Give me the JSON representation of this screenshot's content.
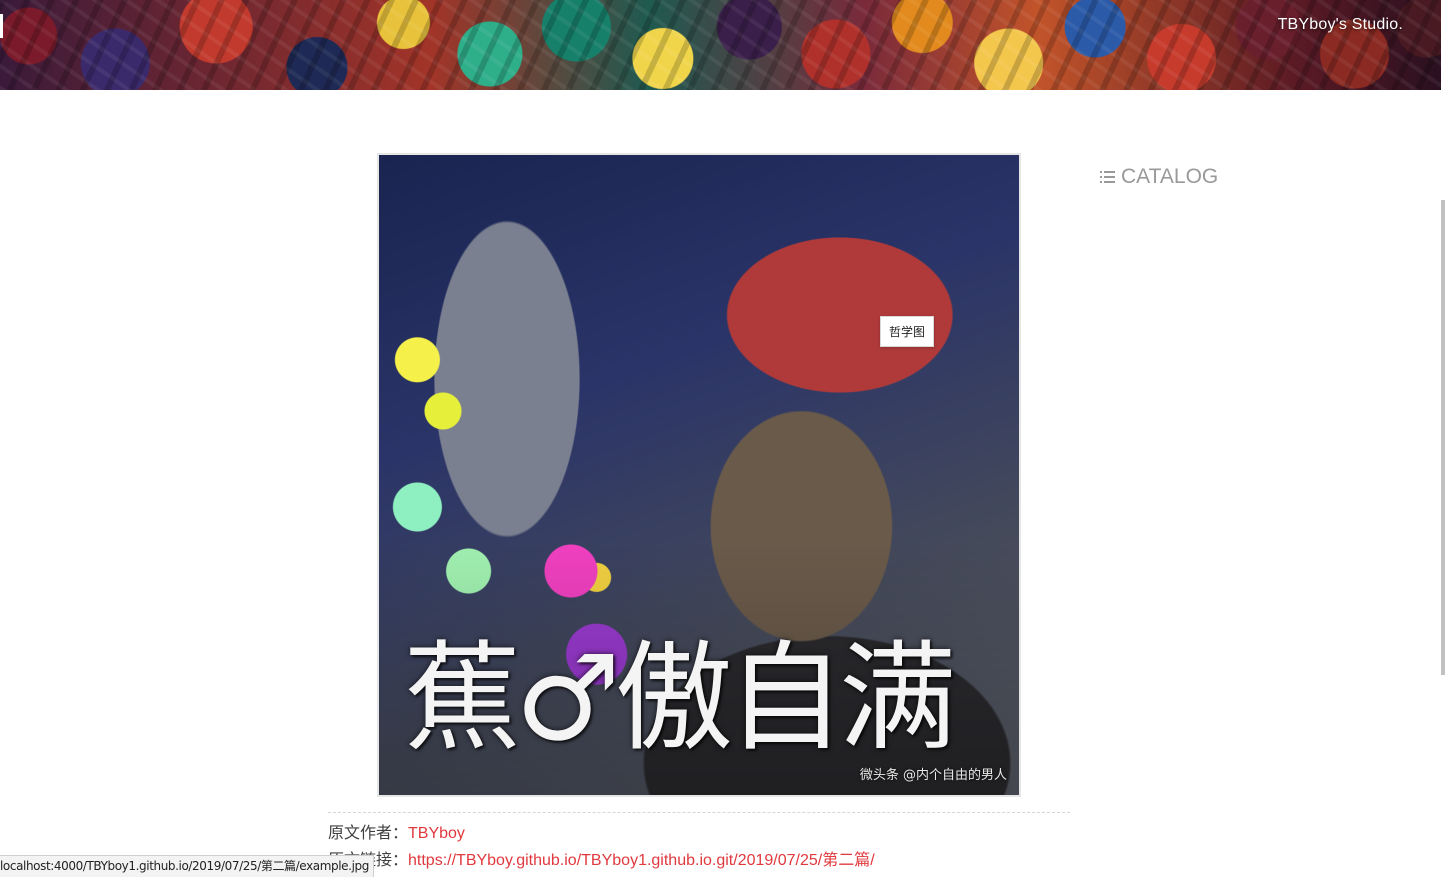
{
  "header": {
    "brand": "TBYboy's Studio."
  },
  "post": {
    "image_alt": "哲学图",
    "image_caption": "蕉♂傲自满",
    "image_watermark": "微头条 @内个自由的男人",
    "tooltip": "哲学图"
  },
  "sidebar": {
    "catalog_label": "CATALOG"
  },
  "copyright": {
    "author_key": "原文作者：",
    "author_value": "TBYboy",
    "link_key": "原文链接：",
    "link_value": "https://TBYboy.github.io/TBYboy1.github.io.git/2019/07/25/第二篇/"
  },
  "status_bar": {
    "url": "localhost:4000/TBYboy1.github.io/2019/07/25/第二篇/example.jpg"
  }
}
